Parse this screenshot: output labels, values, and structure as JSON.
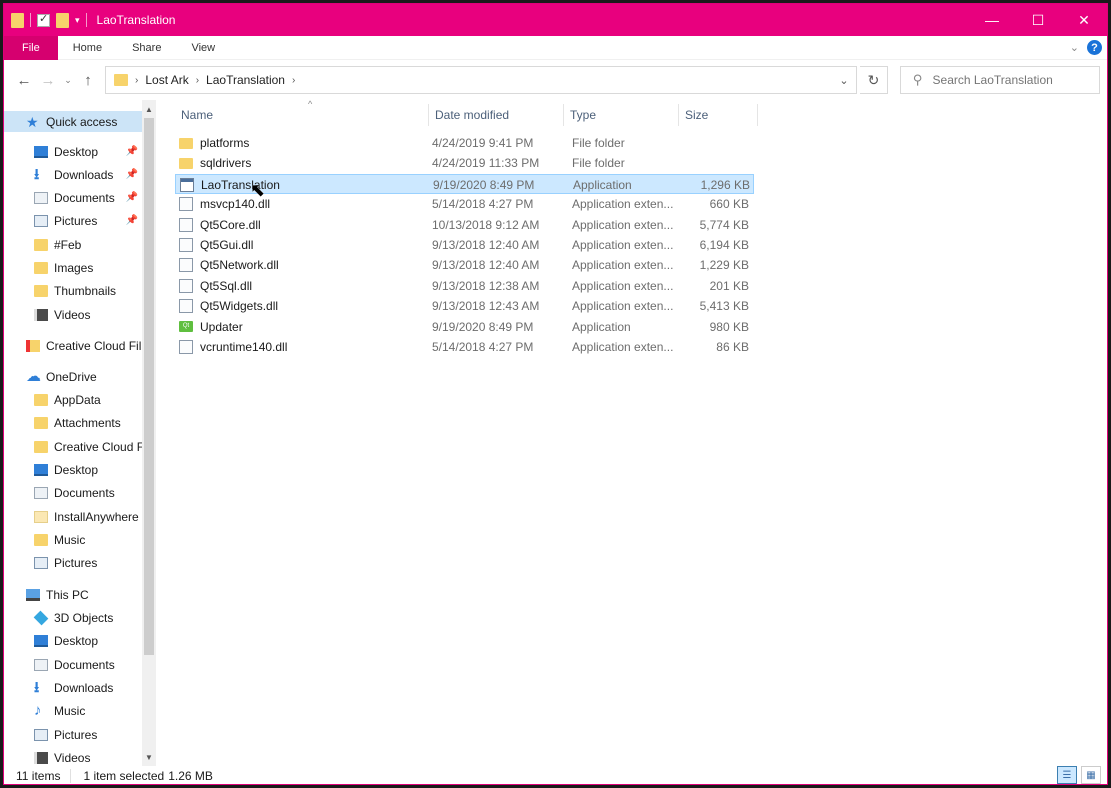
{
  "window": {
    "title": "LaoTranslation"
  },
  "ribbon": {
    "tabs": [
      "File",
      "Home",
      "Share",
      "View"
    ]
  },
  "address": {
    "crumbs": [
      "Lost Ark",
      "LaoTranslation"
    ],
    "search_placeholder": "Search LaoTranslation"
  },
  "nav": {
    "items": [
      {
        "label": "Quick access",
        "icon": "star-icon",
        "indent": 0,
        "selected": true
      },
      {
        "label": "Desktop",
        "icon": "desktop-icon",
        "indent": 1,
        "pinned": true
      },
      {
        "label": "Downloads",
        "icon": "download-icon",
        "indent": 1,
        "pinned": true
      },
      {
        "label": "Documents",
        "icon": "documents-icon",
        "indent": 1,
        "pinned": true
      },
      {
        "label": "Pictures",
        "icon": "pictures-icon",
        "indent": 1,
        "pinned": true
      },
      {
        "label": "#Feb",
        "icon": "folder-icon",
        "indent": 1
      },
      {
        "label": "Images",
        "icon": "folder-icon",
        "indent": 1
      },
      {
        "label": "Thumbnails",
        "icon": "folder-icon",
        "indent": 1
      },
      {
        "label": "Videos",
        "icon": "videos-icon",
        "indent": 1
      },
      {
        "label": "Creative Cloud Fil",
        "icon": "creative-cloud-icon",
        "indent": 0
      },
      {
        "label": "OneDrive",
        "icon": "onedrive-icon",
        "indent": 0
      },
      {
        "label": "AppData",
        "icon": "folder-icon",
        "indent": 1
      },
      {
        "label": "Attachments",
        "icon": "folder-icon",
        "indent": 1
      },
      {
        "label": "Creative Cloud F",
        "icon": "folder-icon",
        "indent": 1
      },
      {
        "label": "Desktop",
        "icon": "desktop-icon",
        "indent": 1
      },
      {
        "label": "Documents",
        "icon": "documents-icon",
        "indent": 1
      },
      {
        "label": "InstallAnywhere",
        "icon": "folder-light-icon",
        "indent": 1
      },
      {
        "label": "Music",
        "icon": "folder-icon",
        "indent": 1
      },
      {
        "label": "Pictures",
        "icon": "pictures-icon",
        "indent": 1
      },
      {
        "label": "This PC",
        "icon": "computer-icon",
        "indent": 0
      },
      {
        "label": "3D Objects",
        "icon": "3d-objects-icon",
        "indent": 1
      },
      {
        "label": "Desktop",
        "icon": "desktop-icon",
        "indent": 1
      },
      {
        "label": "Documents",
        "icon": "documents-icon",
        "indent": 1
      },
      {
        "label": "Downloads",
        "icon": "download-icon",
        "indent": 1
      },
      {
        "label": "Music",
        "icon": "music-icon",
        "indent": 1
      },
      {
        "label": "Pictures",
        "icon": "pictures-icon",
        "indent": 1
      },
      {
        "label": "Videos",
        "icon": "videos-icon",
        "indent": 1
      }
    ]
  },
  "columns": {
    "name": "Name",
    "date": "Date modified",
    "type": "Type",
    "size": "Size"
  },
  "files": [
    {
      "name": "platforms",
      "date": "4/24/2019 9:41 PM",
      "type": "File folder",
      "size": "",
      "icon": "folder-icon"
    },
    {
      "name": "sqldrivers",
      "date": "4/24/2019 11:33 PM",
      "type": "File folder",
      "size": "",
      "icon": "folder-icon"
    },
    {
      "name": "LaoTranslation",
      "date": "9/19/2020 8:49 PM",
      "type": "Application",
      "size": "1,296 KB",
      "icon": "application-icon",
      "selected": true
    },
    {
      "name": "msvcp140.dll",
      "date": "5/14/2018 4:27 PM",
      "type": "Application exten...",
      "size": "660 KB",
      "icon": "dll-icon"
    },
    {
      "name": "Qt5Core.dll",
      "date": "10/13/2018 9:12 AM",
      "type": "Application exten...",
      "size": "5,774 KB",
      "icon": "dll-icon"
    },
    {
      "name": "Qt5Gui.dll",
      "date": "9/13/2018 12:40 AM",
      "type": "Application exten...",
      "size": "6,194 KB",
      "icon": "dll-icon"
    },
    {
      "name": "Qt5Network.dll",
      "date": "9/13/2018 12:40 AM",
      "type": "Application exten...",
      "size": "1,229 KB",
      "icon": "dll-icon"
    },
    {
      "name": "Qt5Sql.dll",
      "date": "9/13/2018 12:38 AM",
      "type": "Application exten...",
      "size": "201 KB",
      "icon": "dll-icon"
    },
    {
      "name": "Qt5Widgets.dll",
      "date": "9/13/2018 12:43 AM",
      "type": "Application exten...",
      "size": "5,413 KB",
      "icon": "dll-icon"
    },
    {
      "name": "Updater",
      "date": "9/19/2020 8:49 PM",
      "type": "Application",
      "size": "980 KB",
      "icon": "qt-updater-icon",
      "icon_text": "Qt"
    },
    {
      "name": "vcruntime140.dll",
      "date": "5/14/2018 4:27 PM",
      "type": "Application exten...",
      "size": "86 KB",
      "icon": "dll-icon"
    }
  ],
  "status": {
    "count": "11 items",
    "selection": "1 item selected",
    "size": "1.26 MB"
  },
  "colors": {
    "titlebar": "#e8007e",
    "file_tab": "#d6006f",
    "selection": "#cce8ff",
    "accent": "#2f7fd7"
  }
}
